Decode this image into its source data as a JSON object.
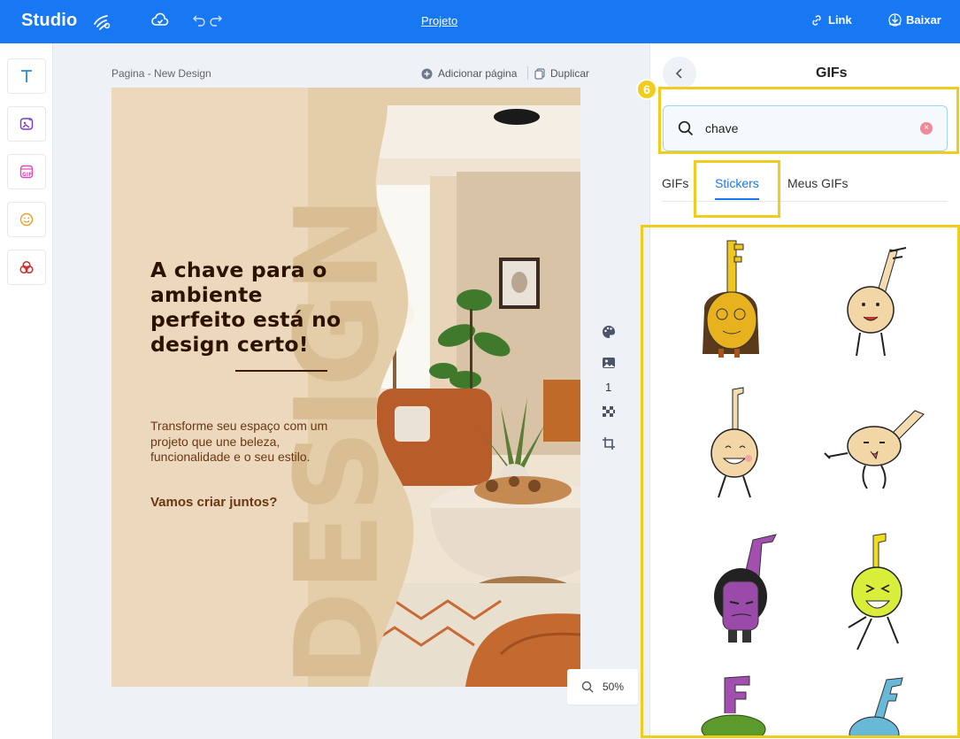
{
  "topbar": {
    "brand": "Studio",
    "project_link": "Projeto",
    "link_label": "Link",
    "download_label": "Baixar"
  },
  "tools": [
    "text-icon",
    "image-magic-icon",
    "gif-icon",
    "emoji-icon",
    "elements-icon"
  ],
  "canvas": {
    "page_title": "Pagina - New Design",
    "add_page": "Adicionar página",
    "duplicate": "Duplicar",
    "page_number": "1",
    "zoom": "50%"
  },
  "design": {
    "headline": "A chave para o ambiente perfeito está no design certo!",
    "body": "Transforme seu espaço com um projeto que une beleza, funcionalidade e o seu estilo.",
    "cta": "Vamos criar juntos?",
    "watermark": "DESIGN"
  },
  "panel": {
    "title": "GIFs",
    "badge": "6",
    "search_value": "chave",
    "tabs": [
      {
        "label": "GIFs",
        "active": false
      },
      {
        "label": "Stickers",
        "active": true
      },
      {
        "label": "Meus GIFs",
        "active": false
      }
    ]
  },
  "colors": {
    "brand_blue": "#1877f2",
    "highlight": "#f2cc1d",
    "design_bg": "#ecd9bd",
    "headline": "#2e1200"
  }
}
